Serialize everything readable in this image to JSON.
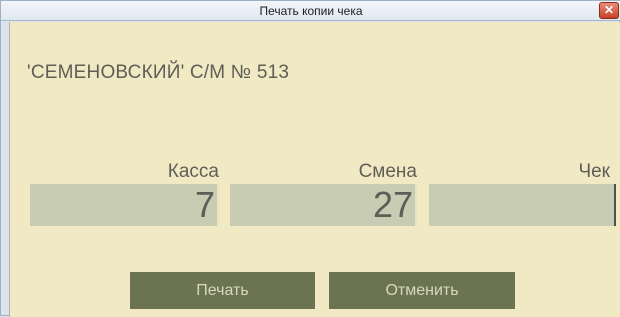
{
  "window": {
    "title": "Печать копии чека",
    "close_glyph": "✕"
  },
  "store": {
    "name": "'СЕМЕНОВСКИЙ' С/М № 513"
  },
  "fields": {
    "kassa": {
      "label": "Касса",
      "value": "7"
    },
    "smena": {
      "label": "Смена",
      "value": "27"
    },
    "chek": {
      "label": "Чек",
      "value": ""
    }
  },
  "buttons": {
    "print": "Печать",
    "cancel": "Отменить"
  },
  "colors": {
    "background": "#f1e9c4",
    "field_bg": "#c8ccb3",
    "button_bg": "#6b7350",
    "button_text": "#d6d9c2",
    "text": "#5e5e55"
  }
}
